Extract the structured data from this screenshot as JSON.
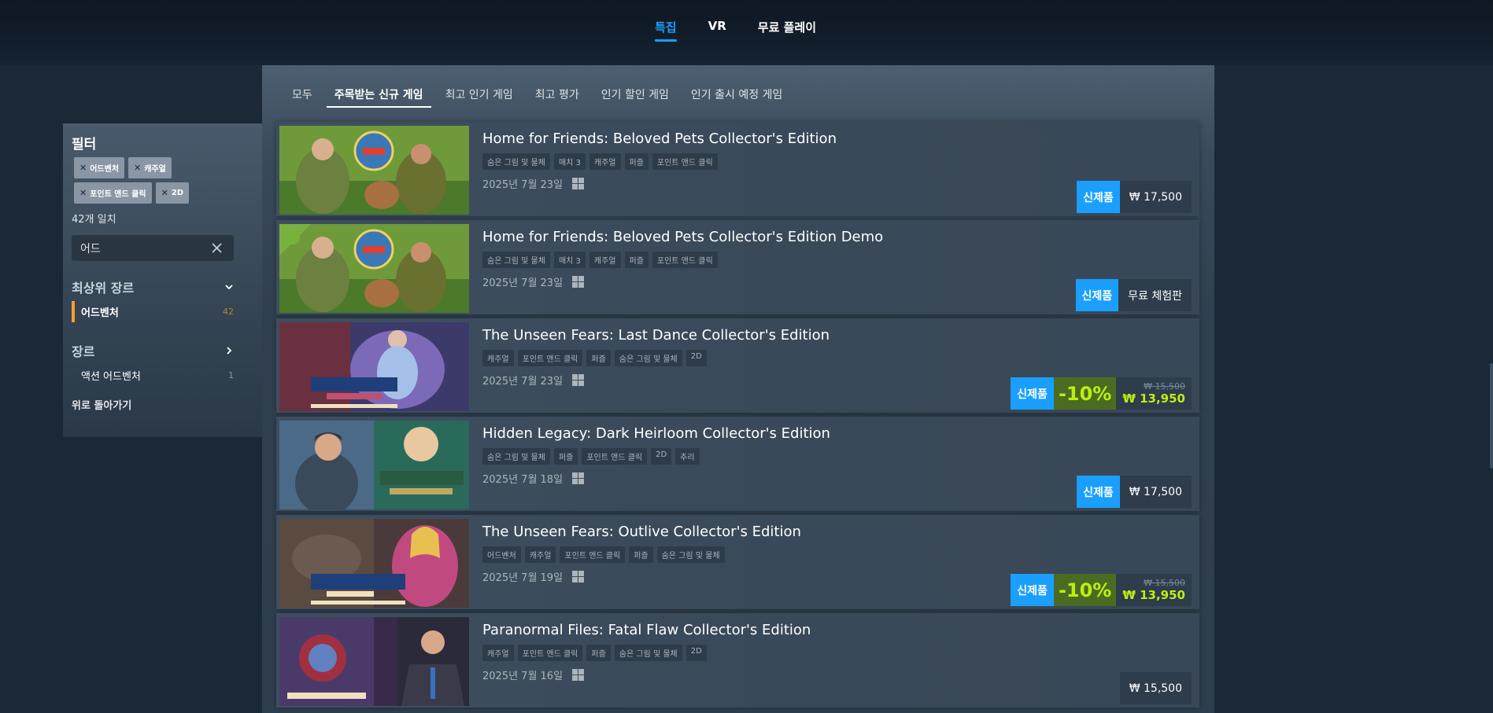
{
  "top_tabs": [
    {
      "label": "특집",
      "active": true
    },
    {
      "label": "VR",
      "active": false
    },
    {
      "label": "무료 플레이",
      "active": false
    }
  ],
  "filter": {
    "title": "필터",
    "chips": [
      "어드벤처",
      "캐주얼",
      "포인트 앤드 클릭",
      "2D"
    ],
    "match_count": "42개 일치",
    "search_value": "어드",
    "top_genre_heading": "최상위 장르",
    "top_genre": {
      "label": "어드벤처",
      "count": "42"
    },
    "genre_heading": "장르",
    "genre": {
      "label": "액션 어드벤처",
      "count": "1"
    },
    "back_label": "위로 돌아가기"
  },
  "sub_tabs": [
    {
      "label": "모두",
      "active": false
    },
    {
      "label": "주목받는 신규 게임",
      "active": true
    },
    {
      "label": "최고 인기 게임",
      "active": false
    },
    {
      "label": "최고 평가",
      "active": false
    },
    {
      "label": "인기 할인 게임",
      "active": false
    },
    {
      "label": "인기 출시 예정 게임",
      "active": false
    }
  ],
  "games": [
    {
      "title": "Home for Friends: Beloved Pets Collector's Edition",
      "tags": [
        "숨은 그림 및 물체",
        "매치 3",
        "캐주얼",
        "퍼즐",
        "포인트 앤드 클릭"
      ],
      "date": "2025년 7월 23일",
      "badge": "신제품",
      "price": "₩ 17,500",
      "thumb_style": "home"
    },
    {
      "title": "Home for Friends: Beloved Pets Collector's Edition Demo",
      "tags": [
        "숨은 그림 및 물체",
        "매치 3",
        "캐주얼",
        "퍼즐",
        "포인트 앤드 클릭"
      ],
      "date": "2025년 7월 23일",
      "badge": "신제품",
      "price": "무료 체험판",
      "thumb_style": "home-demo"
    },
    {
      "title": "The Unseen Fears: Last Dance Collector's Edition",
      "tags": [
        "캐주얼",
        "포인트 앤드 클릭",
        "퍼즐",
        "숨은 그림 및 물체",
        "2D"
      ],
      "date": "2025년 7월 23일",
      "badge": "신제품",
      "discount": "-10%",
      "orig_price": "₩ 15,500",
      "final_price": "₩ 13,950",
      "thumb_style": "unseen-dance"
    },
    {
      "title": "Hidden Legacy: Dark Heirloom Collector's Edition",
      "tags": [
        "숨은 그림 및 물체",
        "퍼즐",
        "포인트 앤드 클릭",
        "2D",
        "추리"
      ],
      "date": "2025년 7월 18일",
      "badge": "신제품",
      "price": "₩ 17,500",
      "thumb_style": "hidden-legacy"
    },
    {
      "title": "The Unseen Fears: Outlive Collector's Edition",
      "tags": [
        "어드벤처",
        "캐주얼",
        "포인트 앤드 클릭",
        "퍼즐",
        "숨은 그림 및 물체"
      ],
      "date": "2025년 7월 19일",
      "badge": "신제품",
      "discount": "-10%",
      "orig_price": "₩ 15,500",
      "final_price": "₩ 13,950",
      "thumb_style": "unseen-outlive"
    },
    {
      "title": "Paranormal Files: Fatal Flaw Collector's Edition",
      "tags": [
        "캐주얼",
        "포인트 앤드 클릭",
        "퍼즐",
        "숨은 그림 및 물체",
        "2D"
      ],
      "date": "2025년 7월 16일",
      "price": "₩ 15,500",
      "thumb_style": "paranormal"
    }
  ],
  "colors": {
    "accent_blue": "#1a9fff",
    "discount_green": "#beee11",
    "active_genre_orange": "#f79f2a"
  }
}
